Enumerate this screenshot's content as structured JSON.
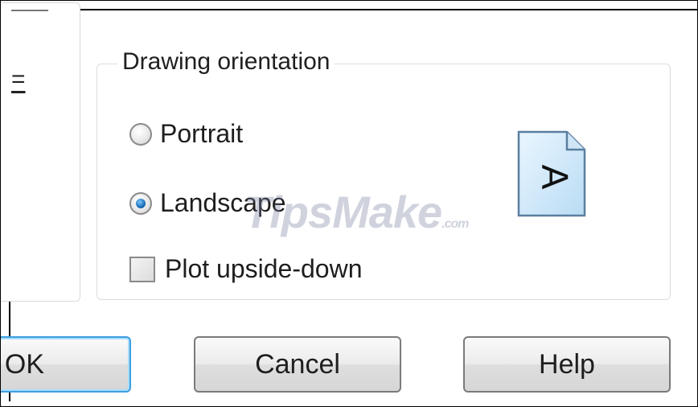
{
  "left_panel": {
    "mnemonic_glyph": "="
  },
  "group": {
    "title": "Drawing orientation",
    "options": {
      "portrait": {
        "label": "Portrait",
        "checked": false
      },
      "landscape": {
        "label": "Landscape",
        "checked": true
      },
      "plot_upside_down": {
        "label": "Plot upside-down",
        "checked": false
      }
    },
    "page_icon": {
      "icon": "page-landscape-icon",
      "letter": "A"
    }
  },
  "watermark": {
    "main": "TipsMake",
    "suffix": ".com"
  },
  "buttons": {
    "ok_label": "OK",
    "cancel_label": "Cancel",
    "help_label": "Help"
  },
  "colors": {
    "focus_border": "#3c9fe0",
    "radio_dot": "#1b6fb8",
    "page_fill": "#d8ecfa"
  }
}
